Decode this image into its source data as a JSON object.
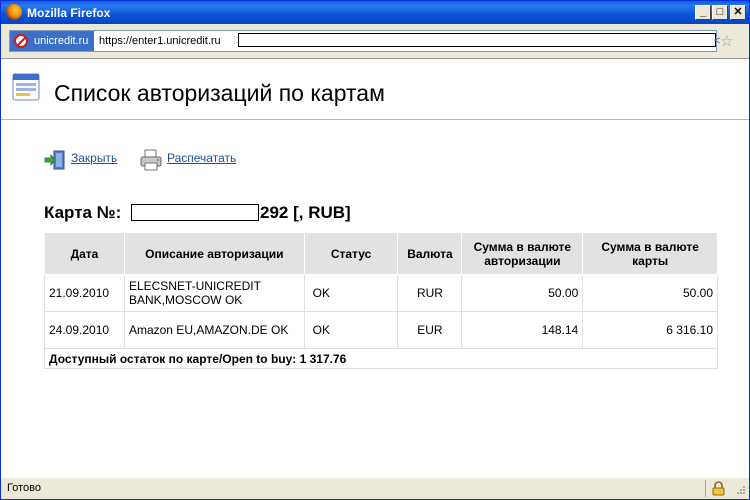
{
  "window": {
    "title": "Mozilla Firefox",
    "min": "_",
    "max": "□",
    "close": "✕"
  },
  "addressbar": {
    "site_identity": "unicredit.ru",
    "url": "https://enter1.unicredit.ru",
    "right_glyph": "<"
  },
  "page": {
    "title": "Список авторизаций по картам",
    "actions": {
      "close_label": "Закрыть",
      "print_label": "Распечатать"
    },
    "card": {
      "label": "Карта №:",
      "suffix": "292 [, RUB]"
    },
    "table": {
      "headers": [
        "Дата",
        "Описание авторизации",
        "Статус",
        "Валюта",
        "Сумма в валюте авторизации",
        "Сумма в валюте карты"
      ],
      "rows": [
        {
          "date": "21.09.2010",
          "description": "ELECSNET-UNICREDIT BANK,MOSCOW  OK",
          "status": "OK",
          "currency": "RUR",
          "auth_amount": "50.00",
          "card_amount": "50.00"
        },
        {
          "date": "24.09.2010",
          "description": "Amazon EU,AMAZON.DE  OK",
          "status": "OK",
          "currency": "EUR",
          "auth_amount": "148.14",
          "card_amount": "6 316.10"
        }
      ],
      "footer": "Доступный остаток по карте/Open to buy:  1 317.76"
    }
  },
  "statusbar": {
    "text": "Готово"
  }
}
